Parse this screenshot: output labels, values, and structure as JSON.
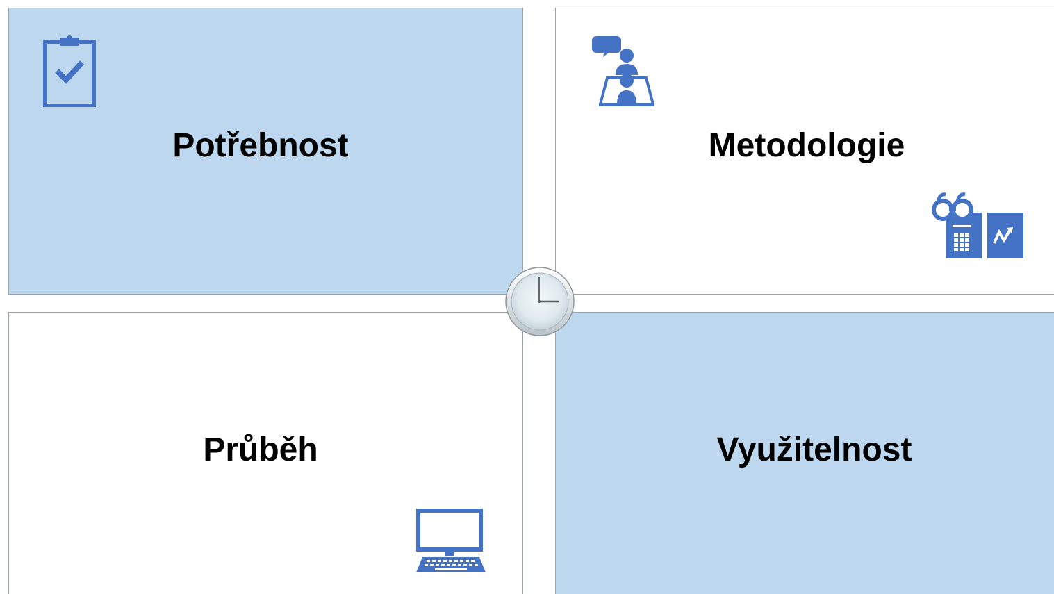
{
  "quadrants": {
    "top_left": {
      "label": "Potřebnost",
      "icon": "clipboard-check-icon"
    },
    "top_right": {
      "label": "Metodologie",
      "icon": "presenter-icon",
      "secondary_icon": "binoculars-report-icon"
    },
    "bottom_left": {
      "label": "Průběh",
      "icon": "desktop-computer-icon"
    },
    "bottom_right": {
      "label": "Využitelnost"
    }
  },
  "center": {
    "icon": "clock-icon"
  },
  "colors": {
    "quadrant_fill_blue": "#bdd7ee",
    "quadrant_fill_white": "#ffffff",
    "icon_blue": "#4472c4",
    "border": "#9aa3ab"
  }
}
